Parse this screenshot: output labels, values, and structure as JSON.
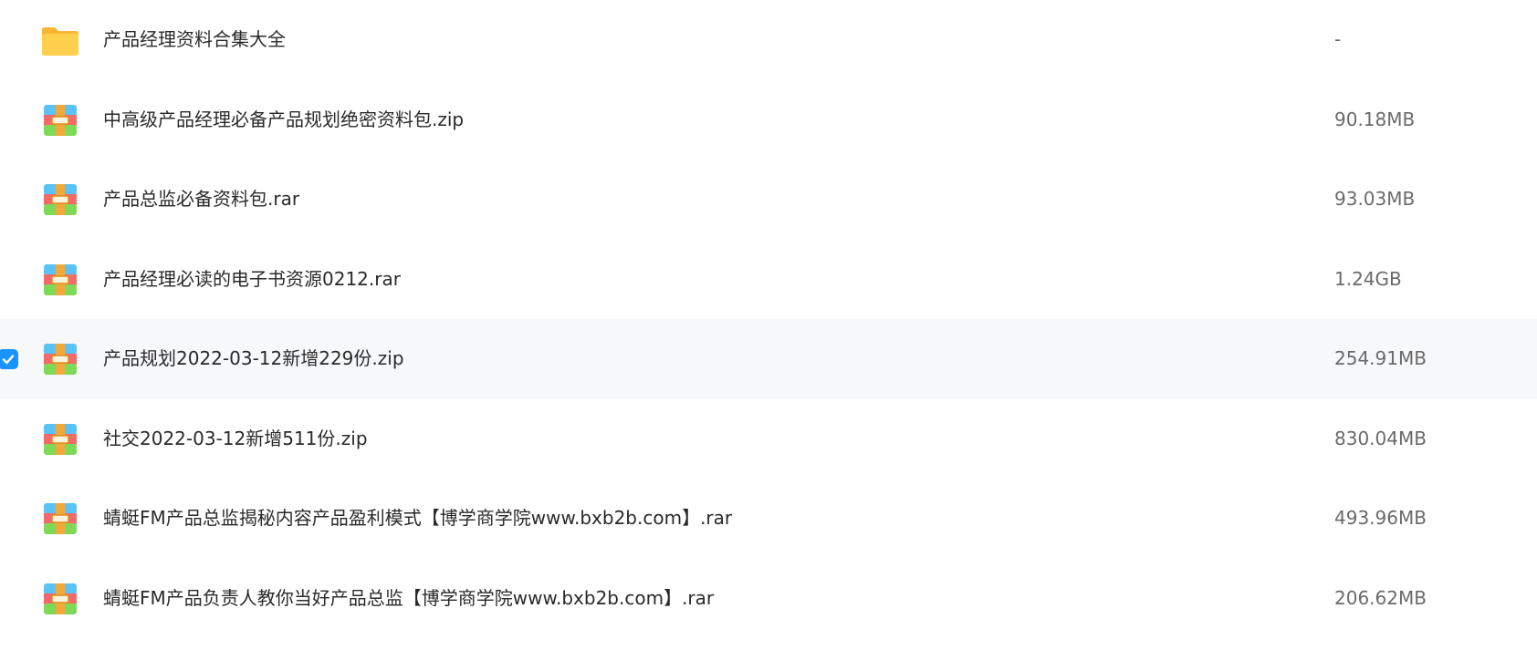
{
  "files": [
    {
      "name": "产品经理资料合集大全",
      "size": "-",
      "type": "folder",
      "icon": "folder-icon",
      "selected": false
    },
    {
      "name": "中高级产品经理必备产品规划绝密资料包.zip",
      "size": "90.18MB",
      "type": "archive",
      "icon": "archive-icon",
      "selected": false
    },
    {
      "name": "产品总监必备资料包.rar",
      "size": "93.03MB",
      "type": "archive",
      "icon": "archive-icon",
      "selected": false
    },
    {
      "name": "产品经理必读的电子书资源0212.rar",
      "size": "1.24GB",
      "type": "archive",
      "icon": "archive-icon",
      "selected": false
    },
    {
      "name": "产品规划2022-03-12新增229份.zip",
      "size": "254.91MB",
      "type": "archive",
      "icon": "archive-icon",
      "selected": true
    },
    {
      "name": "社交2022-03-12新增511份.zip",
      "size": "830.04MB",
      "type": "archive",
      "icon": "archive-icon",
      "selected": false
    },
    {
      "name": "蜻蜓FM产品总监揭秘内容产品盈利模式【博学商学院www.bxb2b.com】.rar",
      "size": "493.96MB",
      "type": "archive",
      "icon": "archive-icon",
      "selected": false
    },
    {
      "name": "蜻蜓FM产品负责人教你当好产品总监【博学商学院www.bxb2b.com】.rar",
      "size": "206.62MB",
      "type": "archive",
      "icon": "archive-icon",
      "selected": false
    }
  ],
  "colors": {
    "selected_row_bg": "#f7f8fa",
    "checkbox_accent": "#1a93ff",
    "folder_yellow": "#ffc83d",
    "archive_blue": "#5bc2f5",
    "archive_red": "#f46a6a",
    "archive_green": "#7ed957",
    "archive_strap": "#f2a93b"
  }
}
